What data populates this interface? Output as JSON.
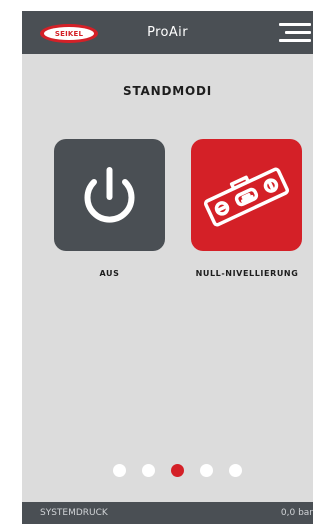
{
  "header": {
    "logo_text": "SEIKEL",
    "title": "ProAir",
    "menu_icon": "hamburger-menu-icon"
  },
  "main": {
    "title": "STANDMODI",
    "modes": [
      {
        "label": "AUS",
        "icon": "power-icon",
        "color": "#4a4f54"
      },
      {
        "label": "NULL-NIVELLIERUNG",
        "icon": "spirit-level-icon",
        "color": "#d42027"
      }
    ]
  },
  "pagination": {
    "count": 5,
    "active_index": 2
  },
  "footer": {
    "label": "SYSTEMDRUCK",
    "value": "0,0 bar"
  },
  "colors": {
    "accent": "#d42027",
    "bar": "#4a4f54",
    "background": "#dcdcdc"
  }
}
